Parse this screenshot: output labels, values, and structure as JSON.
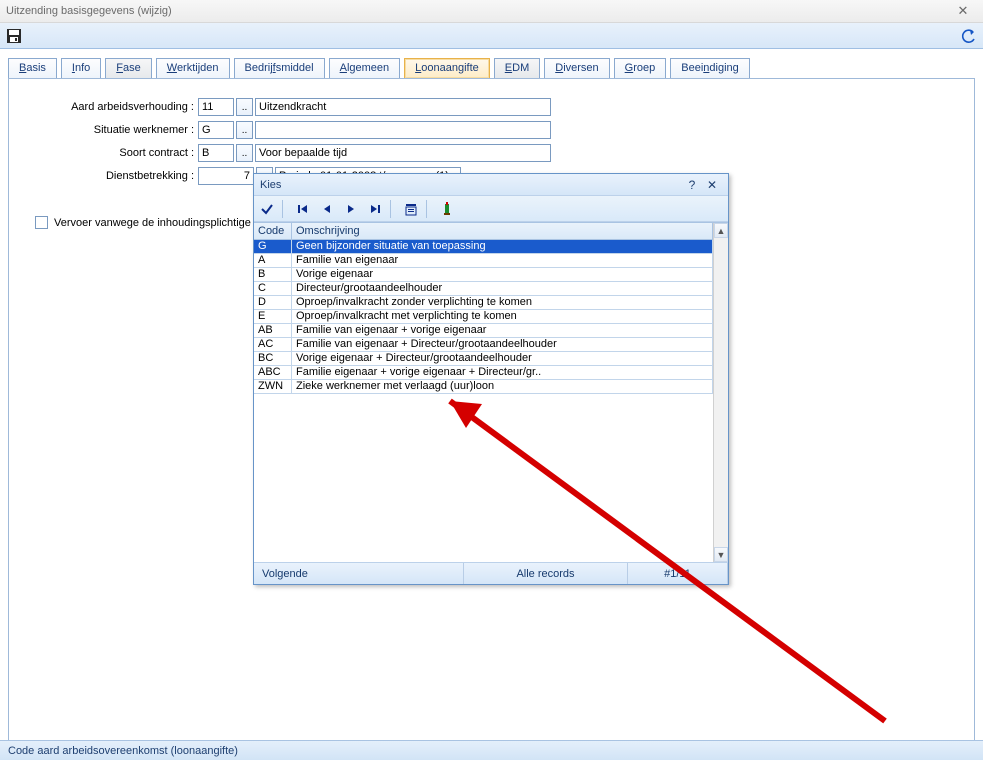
{
  "window": {
    "title": "Uitzending basisgegevens  (wijzig)"
  },
  "tabs": {
    "basis": "Basis",
    "info": "Info",
    "fase": "Fase",
    "werktijden": "Werktijden",
    "bedrijfsmiddel": "Bedrijfsmiddel",
    "algemeen": "Algemeen",
    "loonaangifte": "Loonaangifte",
    "edm": "EDM",
    "diversen": "Diversen",
    "groep": "Groep",
    "beeindiging": "Beeindiging"
  },
  "form": {
    "aard_label": "Aard arbeidsverhouding :",
    "aard_code": "11",
    "aard_desc": "Uitzendkracht",
    "situatie_label": "Situatie werknemer :",
    "situatie_code": "G",
    "situatie_desc": "",
    "soort_label": "Soort contract :",
    "soort_code": "B",
    "soort_desc": "Voor bepaalde tijd",
    "dienst_label": "Dienstbetrekking :",
    "dienst_code": "7",
    "dienst_desc": "Periode 01-01-2008 t/m   - -       (1)",
    "vervoer_label": "Vervoer vanwege de inhoudingsplichtige"
  },
  "dialog": {
    "title": "Kies",
    "col_code": "Code",
    "col_desc": "Omschrijving",
    "rows": [
      {
        "code": "G",
        "desc": "Geen bijzonder situatie van toepassing",
        "selected": true
      },
      {
        "code": "A",
        "desc": "Familie van eigenaar"
      },
      {
        "code": "B",
        "desc": "Vorige eigenaar"
      },
      {
        "code": "C",
        "desc": "Directeur/grootaandeelhouder"
      },
      {
        "code": "D",
        "desc": "Oproep/invalkracht zonder verplichting te komen"
      },
      {
        "code": "E",
        "desc": "Oproep/invalkracht met verplichting te komen"
      },
      {
        "code": "AB",
        "desc": "Familie van eigenaar + vorige eigenaar"
      },
      {
        "code": "AC",
        "desc": "Familie van eigenaar + Directeur/grootaandeelhouder"
      },
      {
        "code": "BC",
        "desc": "Vorige eigenaar + Directeur/grootaandeelhouder"
      },
      {
        "code": "ABC",
        "desc": "Familie eigenaar + vorige eigenaar + Directeur/gr.."
      },
      {
        "code": "ZWN",
        "desc": "Zieke werknemer met verlaagd (uur)loon"
      }
    ],
    "status_next": "Volgende",
    "status_all": "Alle records",
    "status_count": "#1/11"
  },
  "statusbar": {
    "text": "Code aard arbeidsovereenkomst (loonaangifte)"
  }
}
